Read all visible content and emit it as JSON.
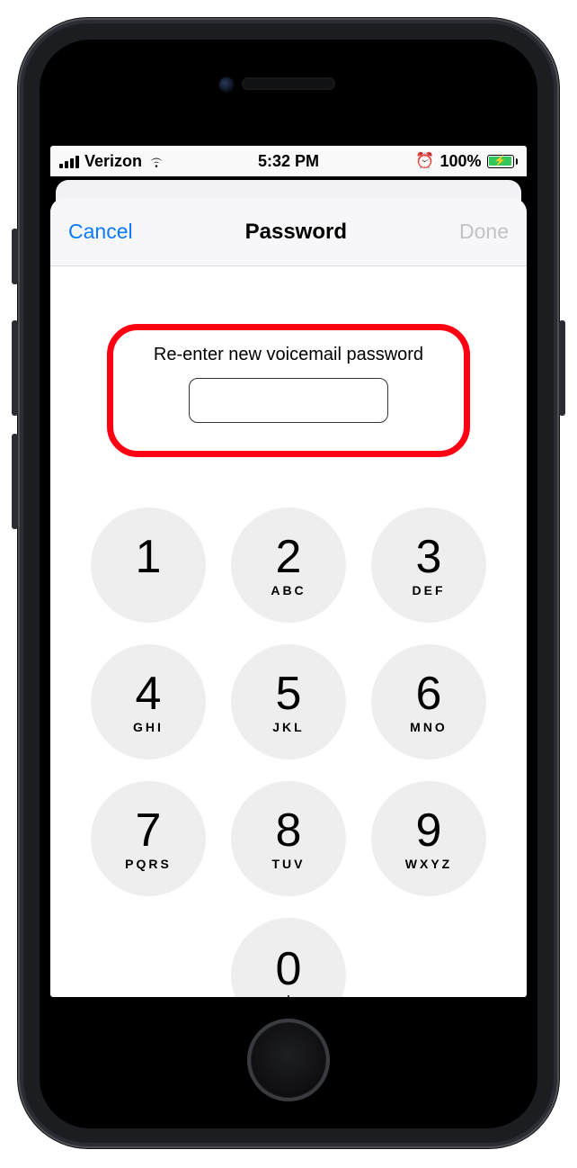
{
  "status": {
    "carrier": "Verizon",
    "time": "5:32 PM",
    "battery_percent": "100%"
  },
  "nav": {
    "cancel": "Cancel",
    "title": "Password",
    "done": "Done"
  },
  "prompt": {
    "text": "Re-enter new voicemail password",
    "value": ""
  },
  "keypad": [
    {
      "digit": "1",
      "letters": ""
    },
    {
      "digit": "2",
      "letters": "ABC"
    },
    {
      "digit": "3",
      "letters": "DEF"
    },
    {
      "digit": "4",
      "letters": "GHI"
    },
    {
      "digit": "5",
      "letters": "JKL"
    },
    {
      "digit": "6",
      "letters": "MNO"
    },
    {
      "digit": "7",
      "letters": "PQRS"
    },
    {
      "digit": "8",
      "letters": "TUV"
    },
    {
      "digit": "9",
      "letters": "WXYZ"
    },
    {
      "digit": "0",
      "letters": "+"
    }
  ]
}
